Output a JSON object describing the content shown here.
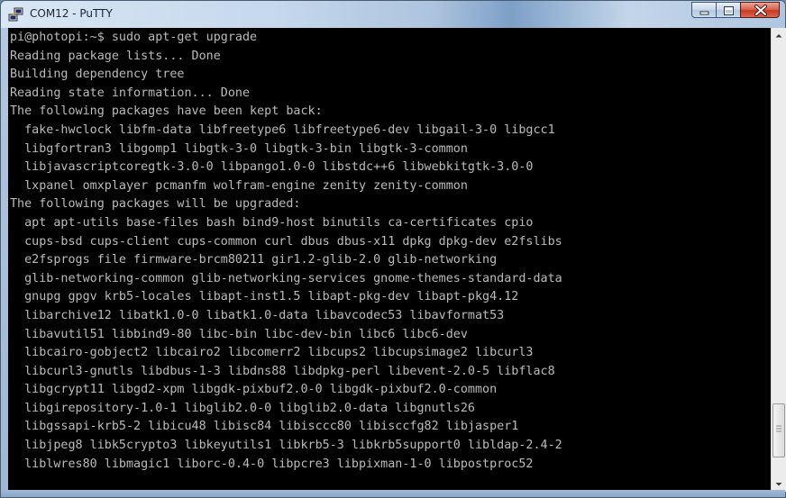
{
  "window": {
    "title": "COM12 - PuTTY",
    "icon": "putty-icon",
    "buttons": {
      "minimize": "minimize-icon",
      "maximize": "maximize-icon",
      "close": "close-icon"
    }
  },
  "terminal": {
    "lines": [
      "pi@photopi:~$ sudo apt-get upgrade",
      "Reading package lists... Done",
      "Building dependency tree",
      "Reading state information... Done",
      "The following packages have been kept back:",
      "  fake-hwclock libfm-data libfreetype6 libfreetype6-dev libgail-3-0 libgcc1",
      "  libgfortran3 libgomp1 libgtk-3-0 libgtk-3-bin libgtk-3-common",
      "  libjavascriptcoregtk-3.0-0 libpango1.0-0 libstdc++6 libwebkitgtk-3.0-0",
      "  lxpanel omxplayer pcmanfm wolfram-engine zenity zenity-common",
      "The following packages will be upgraded:",
      "  apt apt-utils base-files bash bind9-host binutils ca-certificates cpio",
      "  cups-bsd cups-client cups-common curl dbus dbus-x11 dpkg dpkg-dev e2fslibs",
      "  e2fsprogs file firmware-brcm80211 gir1.2-glib-2.0 glib-networking",
      "  glib-networking-common glib-networking-services gnome-themes-standard-data",
      "  gnupg gpgv krb5-locales libapt-inst1.5 libapt-pkg-dev libapt-pkg4.12",
      "  libarchive12 libatk1.0-0 libatk1.0-data libavcodec53 libavformat53",
      "  libavutil51 libbind9-80 libc-bin libc-dev-bin libc6 libc6-dev",
      "  libcairo-gobject2 libcairo2 libcomerr2 libcups2 libcupsimage2 libcurl3",
      "  libcurl3-gnutls libdbus-1-3 libdns88 libdpkg-perl libevent-2.0-5 libflac8",
      "  libgcrypt11 libgd2-xpm libgdk-pixbuf2.0-0 libgdk-pixbuf2.0-common",
      "  libgirepository-1.0-1 libglib2.0-0 libglib2.0-data libgnutls26",
      "  libgssapi-krb5-2 libicu48 libisc84 libisccc80 libisccfg82 libjasper1",
      "  libjpeg8 libk5crypto3 libkeyutils1 libkrb5-3 libkrb5support0 libldap-2.4-2",
      "  liblwres80 libmagic1 liborc-0.4-0 libpcre3 libpixman-1-0 libpostproc52"
    ],
    "foreground": "#bbbbbb",
    "background": "#000000"
  },
  "scrollbar": {
    "up_arrow": "scroll-up-arrow-icon",
    "down_arrow": "scroll-down-arrow-icon"
  }
}
